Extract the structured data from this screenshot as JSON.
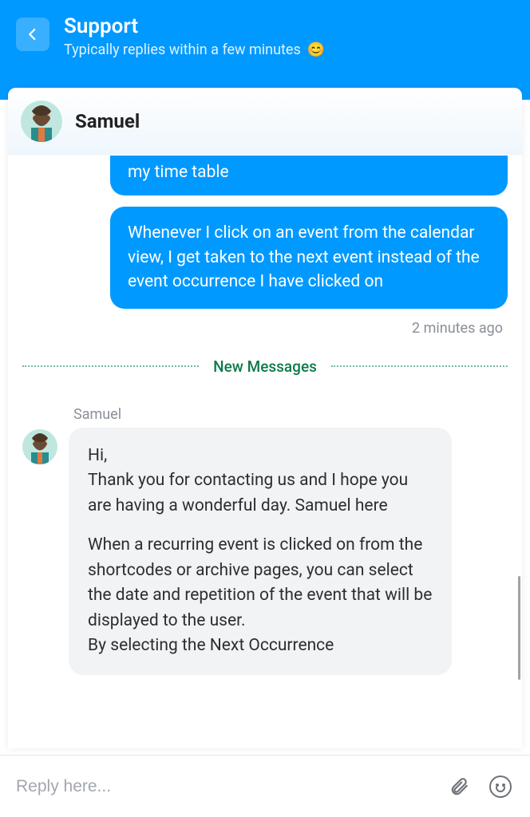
{
  "header": {
    "title": "Support",
    "subtitle": "Typically replies within a few minutes",
    "emoji": "😊"
  },
  "agent": {
    "name": "Samuel"
  },
  "messages": {
    "user1": "my time table",
    "user2": "Whenever I click on an event from the calendar view, I get taken to the next event instead of the event occurrence I have clicked on",
    "timestamp": "2 minutes ago",
    "divider": "New Messages",
    "agent_sender": "Samuel",
    "agent_p1": "Hi,\nThank you for contacting us and I hope you are having a wonderful day. Samuel here",
    "agent_p2": "When a recurring event is clicked on from the shortcodes or archive pages, you can select the date and repetition of the event that will be displayed to the user.\nBy selecting the Next Occurrence"
  },
  "reply": {
    "placeholder": "Reply here..."
  }
}
